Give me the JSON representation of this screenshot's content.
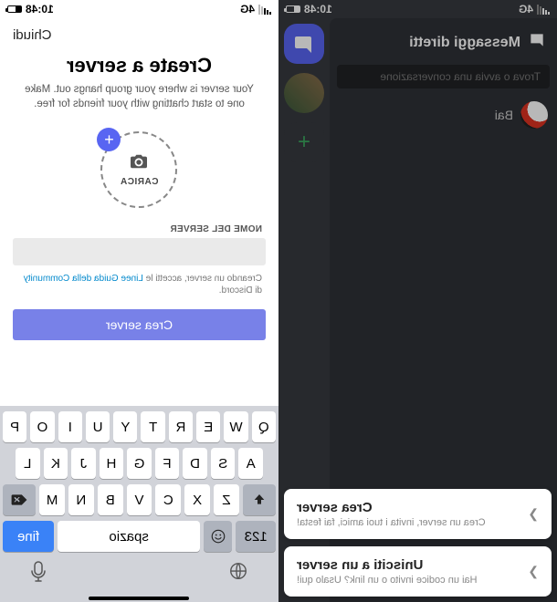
{
  "status": {
    "carrier": "4G",
    "time": "10:48",
    "battery_pct": 40
  },
  "left": {
    "close": "Chiudi",
    "title": "Create a server",
    "subtitle": "Your server is where your group hangs out. Make one to start chatting with your friends for free.",
    "upload_label": "CARICA",
    "field_label": "NOME DEL SERVER",
    "server_name_value": "",
    "terms_prefix": "Creando un server, accetti le ",
    "terms_link": "Linee Guida della Community",
    "terms_suffix": " di Discord.",
    "submit": "Crea server"
  },
  "keyboard": {
    "row1": [
      "Q",
      "W",
      "E",
      "R",
      "T",
      "Y",
      "U",
      "I",
      "O",
      "P"
    ],
    "row2": [
      "A",
      "S",
      "D",
      "F",
      "G",
      "H",
      "J",
      "K",
      "L"
    ],
    "row3": [
      "Z",
      "X",
      "C",
      "V",
      "B",
      "N",
      "M"
    ],
    "numbers": "123",
    "space": "spazio",
    "done": "fine"
  },
  "right": {
    "header": "Messaggi diretti",
    "search_placeholder": "Trova o avvia una conversazione",
    "dm_items": [
      {
        "name": "Bai"
      }
    ],
    "sheet": {
      "create_title": "Crea server",
      "create_sub": "Crea un server, invita i tuoi amici, fai festa!",
      "join_title": "Unisciti a un server",
      "join_sub": "Hai un codice invito o un link? Usalo qui!"
    }
  }
}
